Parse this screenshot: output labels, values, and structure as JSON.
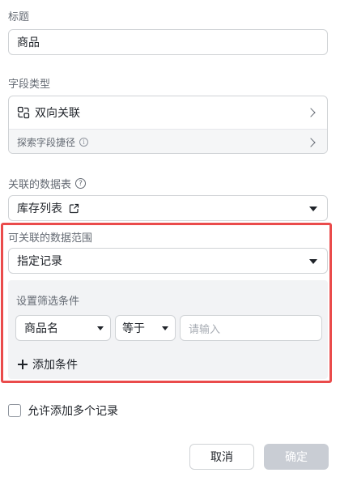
{
  "title_field": {
    "label": "标题",
    "value": "商品"
  },
  "field_type": {
    "label": "字段类型",
    "value": "双向关联",
    "shortcut_label": "探索字段捷径"
  },
  "linked_table": {
    "label": "关联的数据表",
    "value": "库存列表"
  },
  "data_range": {
    "label": "可关联的数据范围",
    "value": "指定记录",
    "filter_title": "设置筛选条件",
    "condition": {
      "field": "商品名",
      "operator": "等于",
      "value_placeholder": "请输入"
    },
    "add_condition_label": "添加条件"
  },
  "allow_multiple": {
    "label": "允许添加多个记录",
    "checked": false
  },
  "buttons": {
    "cancel": "取消",
    "confirm": "确定"
  },
  "colors": {
    "highlight": "#ea4b4b",
    "disabled_button": "#c9cdd4",
    "filter_bg": "#f2f3f5"
  }
}
